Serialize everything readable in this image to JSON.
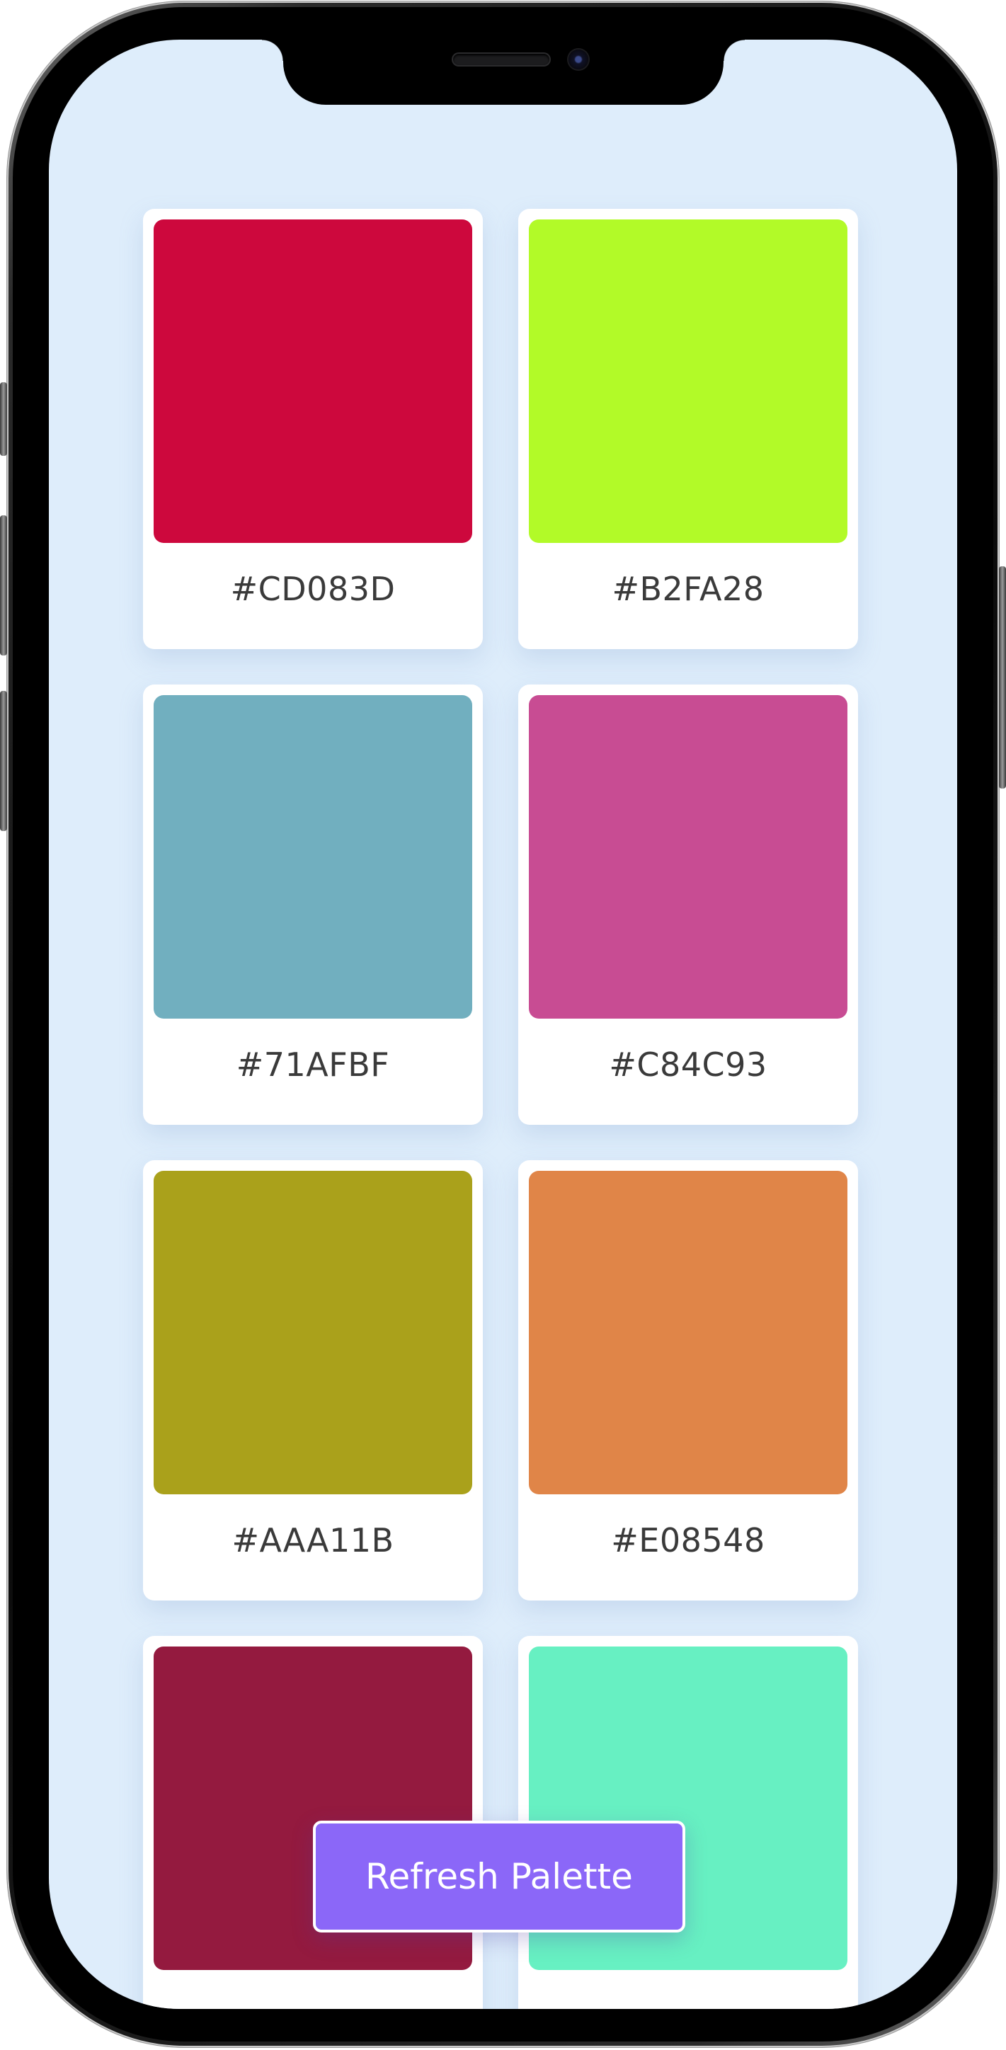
{
  "palette": {
    "colors": [
      {
        "hex": "#CD083D",
        "color": "#CD083D"
      },
      {
        "hex": "#B2FA28",
        "color": "#B2FA28"
      },
      {
        "hex": "#71AFBF",
        "color": "#71AFBF"
      },
      {
        "hex": "#C84C93",
        "color": "#C84C93"
      },
      {
        "hex": "#AAA11B",
        "color": "#AAA11B"
      },
      {
        "hex": "#E08548",
        "color": "#E08548"
      },
      {
        "hex": "",
        "color": "#941A3F"
      },
      {
        "hex": "",
        "color": "#67F0C2"
      }
    ]
  },
  "actions": {
    "refresh_label": "Refresh Palette"
  },
  "theme": {
    "screen_background": "#DEEDFB",
    "button_color": "#8B67F8"
  }
}
